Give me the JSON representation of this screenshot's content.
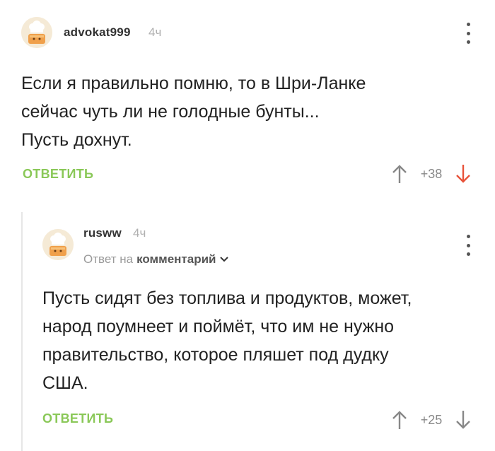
{
  "comments": [
    {
      "username": "advokat999",
      "time": "4ч",
      "lines": [
        "Если я правильно помню, то в Шри-Ланке",
        "сейчас чуть ли не голодные бунты...",
        "Пусть дохнут."
      ],
      "reply_label": "ОТВЕТИТЬ",
      "score": "+38",
      "down_color": "#e8533a"
    },
    {
      "username": "rusww",
      "time": "4ч",
      "reply_to_prefix": "Ответ на",
      "reply_to_target": "комментарий",
      "lines": [
        "Пусть сидят без топлива и продуктов, может,",
        "народ поумнеет и поймёт, что им не нужно",
        "правительство, которое пляшет под дудку",
        "США."
      ],
      "reply_label": "ОТВЕТИТЬ",
      "score": "+25",
      "down_color": "#888888"
    }
  ],
  "colors": {
    "accent_green": "#8ac858",
    "vote_gray": "#888888"
  }
}
